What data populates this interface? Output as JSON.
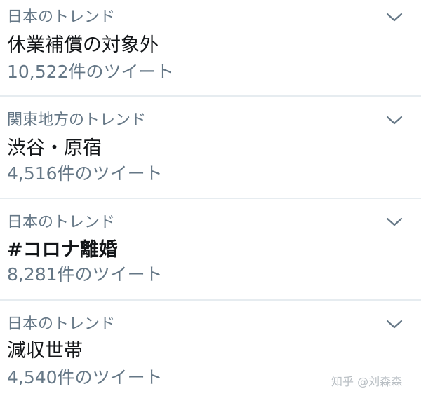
{
  "trends": [
    {
      "context": "日本のトレンド",
      "name": "休業補償の対象外",
      "count": "10,522件のツイート",
      "bold": false
    },
    {
      "context": "関東地方のトレンド",
      "name": "渋谷・原宿",
      "count": "4,516件のツイート",
      "bold": false
    },
    {
      "context": "日本のトレンド",
      "name": "#コロナ離婚",
      "count": "8,281件のツイート",
      "bold": true
    },
    {
      "context": "日本のトレンド",
      "name": "減収世帯",
      "count": "4,540件のツイート",
      "bold": false
    }
  ],
  "icons": {
    "more": "chevron-down-icon"
  },
  "colors": {
    "context_text": "#657786",
    "trend_text": "#14171a",
    "divider": "#e6ecf0",
    "icon": "#657786"
  },
  "watermark": {
    "text": "知乎 @刘森森"
  }
}
